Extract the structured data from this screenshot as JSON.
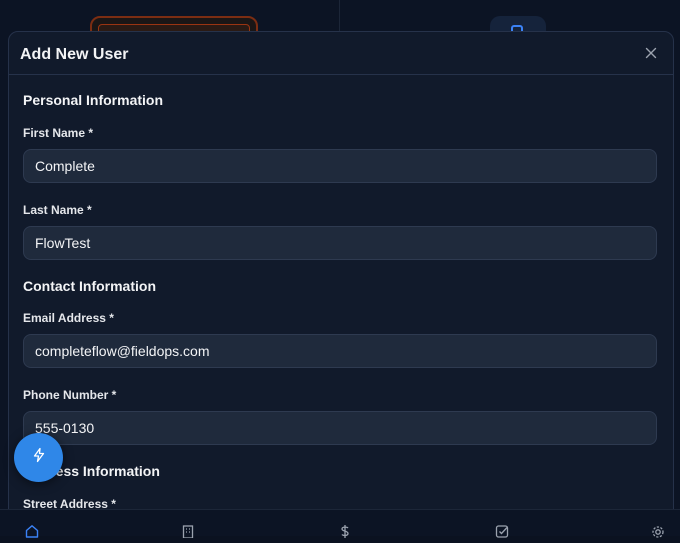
{
  "modal": {
    "title": "Add New User"
  },
  "sections": {
    "personal": "Personal Information",
    "contact": "Contact Information",
    "address": "Address Information"
  },
  "fields": {
    "first_name": {
      "label": "First Name *",
      "value": "Complete"
    },
    "last_name": {
      "label": "Last Name *",
      "value": "FlowTest"
    },
    "email": {
      "label": "Email Address *",
      "value": "completeflow@fieldops.com"
    },
    "phone": {
      "label": "Phone Number *",
      "value": "555-0130"
    },
    "street": {
      "label": "Street Address *"
    }
  },
  "icons": {
    "close": "close-icon",
    "fab": "lightning-icon",
    "nav": [
      "home-icon",
      "building-icon",
      "dollar-icon",
      "checklist-icon",
      "gear-icon"
    ]
  },
  "colors": {
    "accent": "#2f87e8",
    "modal_bg": "#111a2b",
    "input_bg": "#1f2a3c"
  }
}
